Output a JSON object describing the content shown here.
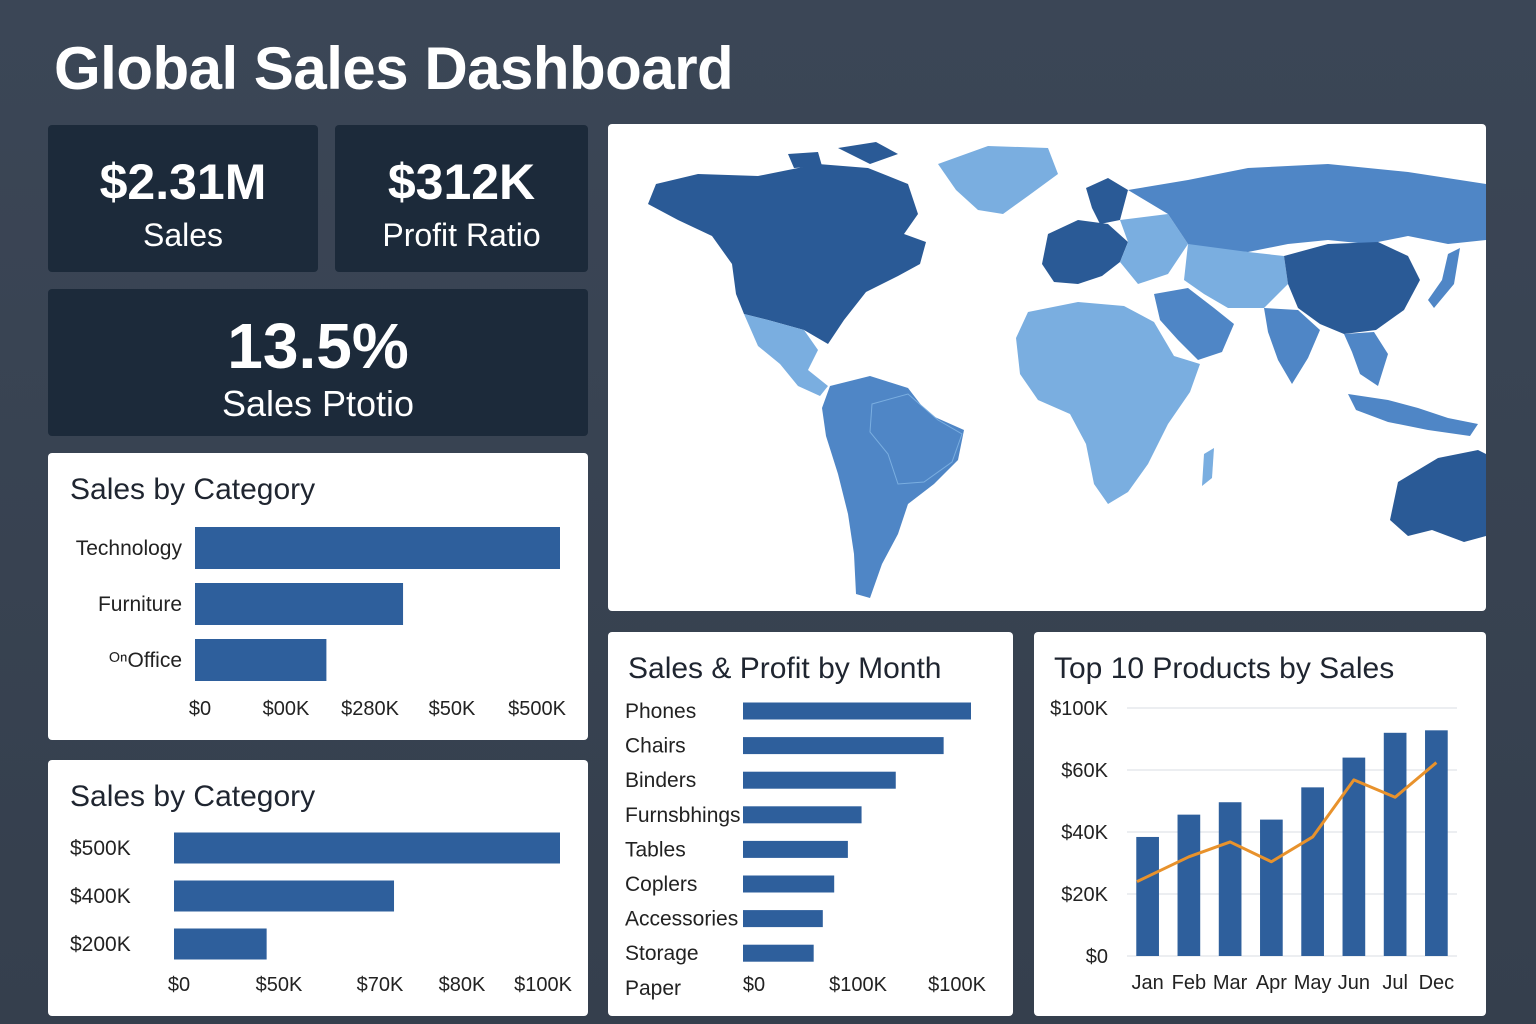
{
  "dashboard": {
    "title": "Global Sales Dashboard"
  },
  "kpis": [
    {
      "value": "$2.31M",
      "label": "Sales"
    },
    {
      "value": "$312K",
      "label": "Profit Ratio"
    },
    {
      "value": "13.5%",
      "label": "Sales Ptotio"
    }
  ],
  "colors": {
    "bar": "#2e5f9c",
    "line": "#e8922c",
    "map_dark": "#2a5a96",
    "map_mid": "#4f86c6",
    "map_light": "#7aaee0"
  },
  "chart_data": [
    {
      "id": "category1",
      "type": "bar",
      "orientation": "horizontal",
      "title": "Sales by Category",
      "categories": [
        "Technology",
        "Furniture",
        "ᴼⁿOffice"
      ],
      "values": [
        100,
        57,
        36
      ],
      "xticks": [
        "$0",
        "$00K",
        "$280K",
        "$50K",
        "$500K"
      ]
    },
    {
      "id": "category2",
      "type": "bar",
      "orientation": "horizontal",
      "title": "Sales by Category",
      "categories": [
        "$500K",
        "$400K",
        "$200K"
      ],
      "values": [
        100,
        57,
        24
      ],
      "xticks": [
        "$0",
        "$50K",
        "$70K",
        "$80K",
        "$100K"
      ]
    },
    {
      "id": "products",
      "type": "bar",
      "orientation": "horizontal",
      "title": "Sales & Profit by Month",
      "categories": [
        "Phones",
        "Chairs",
        "Binders",
        "Furnsbhings",
        "Tables",
        "Coplers",
        "Accessories",
        "Storage",
        "Paper"
      ],
      "values": [
        100,
        88,
        67,
        52,
        46,
        40,
        35,
        31,
        0
      ],
      "xticks": [
        "$0",
        "$100K",
        "$100K"
      ]
    },
    {
      "id": "monthly",
      "type": "bar",
      "title": "Top 10 Products by Sales",
      "categories": [
        "Jan",
        "Feb",
        "Mar",
        "Apr",
        "May",
        "Jun",
        "Jul",
        "Dec"
      ],
      "series": [
        {
          "type": "bar",
          "values": [
            48,
            57,
            62,
            55,
            68,
            80,
            90,
            91
          ]
        },
        {
          "type": "line",
          "values": [
            30,
            40,
            46,
            38,
            48,
            71,
            64,
            78
          ]
        }
      ],
      "yticks": [
        "$100K",
        "$60K",
        "$40K",
        "$20K",
        "$0"
      ],
      "ylim": [
        0,
        100
      ]
    }
  ]
}
